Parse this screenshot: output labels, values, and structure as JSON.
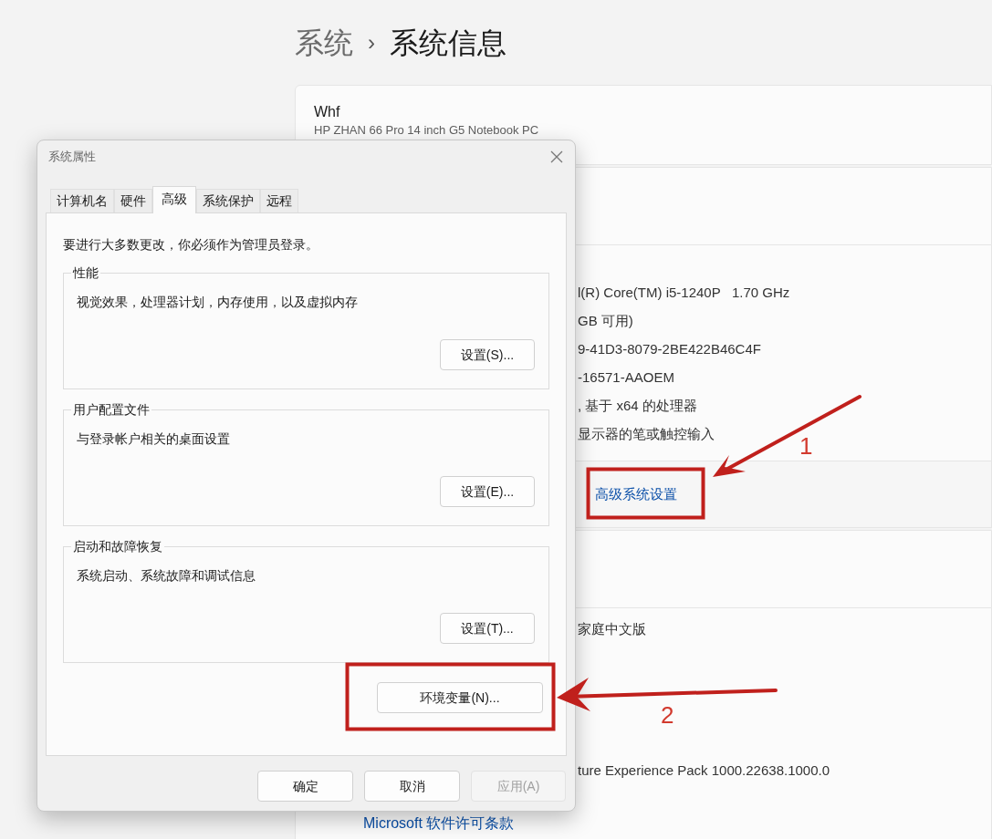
{
  "breadcrumb": {
    "parent": "系统",
    "separator": "›",
    "current": "系统信息"
  },
  "device": {
    "name": "Whf",
    "model": "HP ZHAN 66 Pro 14 inch G5 Notebook PC"
  },
  "device_specs": [
    "l(R) Core(TM) i5-1240P   1.70 GHz",
    "GB 可用)",
    "9-41D3-8079-2BE422B46C4F",
    "-16571-AAOEM",
    ", 基于 x64 的处理器",
    "显示器的笔或触控输入"
  ],
  "related_link": "高级系统设置",
  "windows_specs": [
    "家庭中文版",
    "ture Experience Pack 1000.22638.1000.0"
  ],
  "license_link": "Microsoft 软件许可条款",
  "dialog": {
    "title": "系统属性",
    "tabs": [
      {
        "label": "计算机名",
        "selected": false
      },
      {
        "label": "硬件",
        "selected": false
      },
      {
        "label": "高级",
        "selected": true
      },
      {
        "label": "系统保护",
        "selected": false
      },
      {
        "label": "远程",
        "selected": false
      }
    ],
    "notice": "要进行大多数更改，你必须作为管理员登录。",
    "groups": [
      {
        "title": "性能",
        "description": "视觉效果，处理器计划，内存使用，以及虚拟内存",
        "button": "设置(S)..."
      },
      {
        "title": "用户配置文件",
        "description": "与登录帐户相关的桌面设置",
        "button": "设置(E)..."
      },
      {
        "title": "启动和故障恢复",
        "description": "系统启动、系统故障和调试信息",
        "button": "设置(T)..."
      }
    ],
    "env_button": "环境变量(N)...",
    "buttons": [
      {
        "label": "确定",
        "disabled": false
      },
      {
        "label": "取消",
        "disabled": false
      },
      {
        "label": "应用(A)",
        "disabled": true
      }
    ]
  },
  "annotations": [
    {
      "number": "1"
    },
    {
      "number": "2"
    }
  ]
}
